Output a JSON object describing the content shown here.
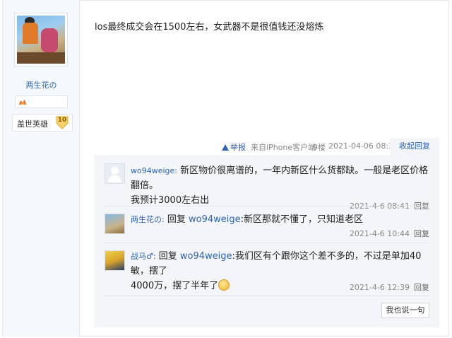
{
  "post": {
    "content": "los最终成交会在1500左右，女武器不是很值钱还没熔炼",
    "report_label": "举报",
    "source": "来自iPhone客户端",
    "floor": "9楼",
    "time": "2021-04-06 08:31",
    "collapse_label": "收起回复"
  },
  "author": {
    "name": "两生花の",
    "title_badge": "盖世英雄",
    "level": "10"
  },
  "replies": [
    {
      "user": "wo94weige:",
      "reply_to": "",
      "text": "新区物价很离谱的，一年内新区什么货都缺。一般是老区价格翻倍。",
      "text2": "我预计3000左右出",
      "time": "2021-4-6 08:41",
      "reply_label": "回复"
    },
    {
      "user": "两生花の:",
      "reply_prefix": "回复",
      "reply_to": "wo94weige",
      "text": ":新区那就不懂了，只知道老区",
      "time": "2021-4-6 10:44",
      "reply_label": "回复"
    },
    {
      "user": "战马♂:",
      "reply_prefix": "回复",
      "reply_to": "wo94weige",
      "text": ":我们区有个跟你这个差不多的，不过是单加40敏，摆了",
      "text2": "4000万，摆了半年了",
      "time": "2021-4-6 12:39",
      "reply_label": "回复"
    }
  ],
  "say_button": "我也说一句",
  "colors": {
    "link": "#2d64b3",
    "panel": "#f3f5f8",
    "sidebar": "#f5f8fc"
  },
  "icons": [
    "fire-badge-icon",
    "level-badge-icon",
    "report-icon",
    "smiley-icon",
    "default-avatar-icon"
  ]
}
